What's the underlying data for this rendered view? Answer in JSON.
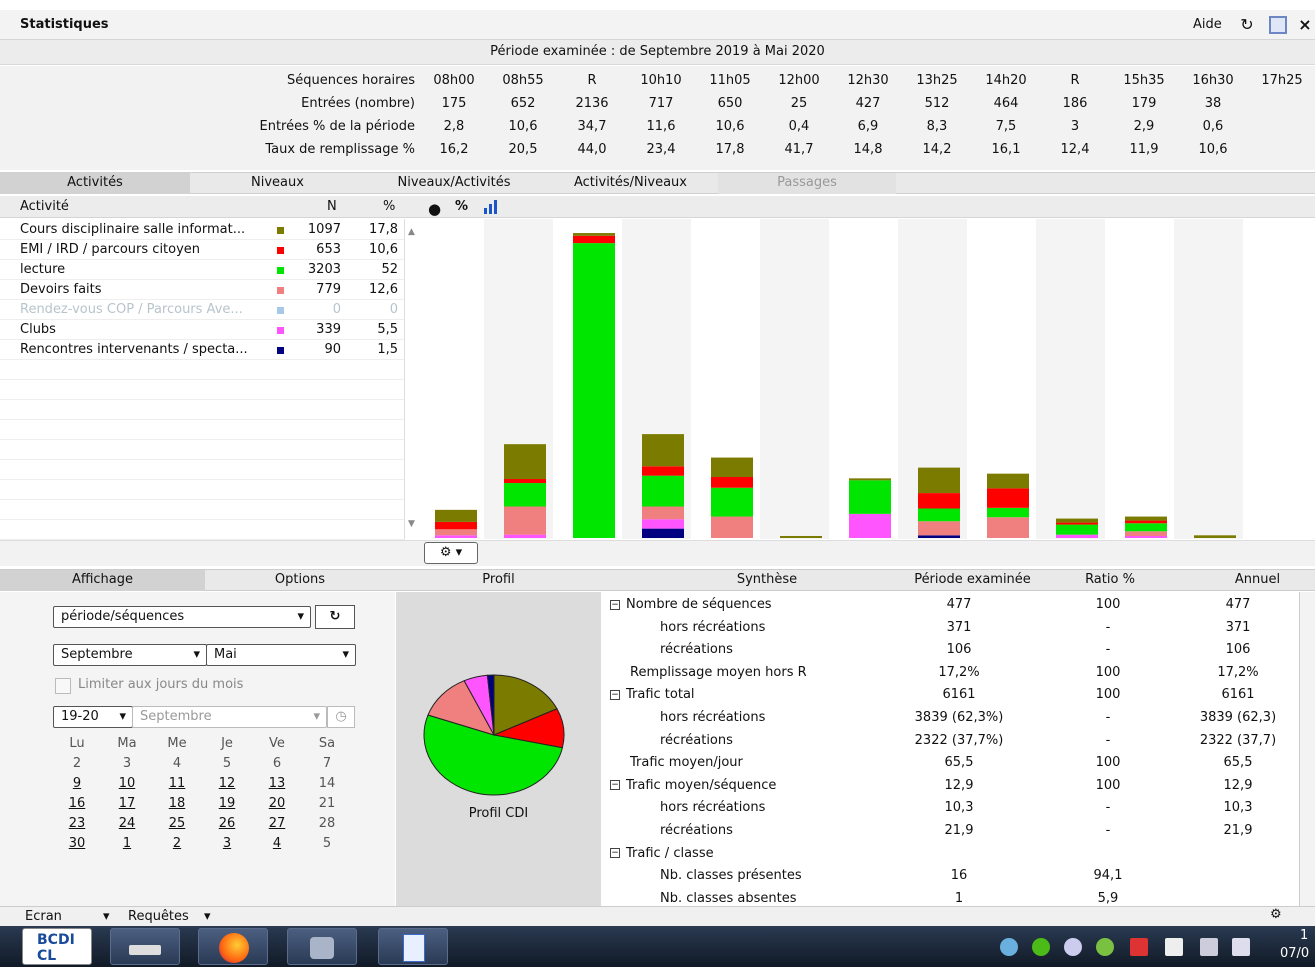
{
  "window": {
    "title": "Statistiques",
    "help": "Aide",
    "refresh_icon": "refresh-icon",
    "restore_icon": "window-icon",
    "close_icon": "×"
  },
  "period": "Période examinée : de Septembre 2019 à Mai 2020",
  "sequences": {
    "row_labels": [
      "Séquences horaires",
      "Entrées (nombre)",
      "Entrées % de la période",
      "Taux de remplissage %"
    ],
    "times": [
      "08h00",
      "08h55",
      "R",
      "10h10",
      "11h05",
      "12h00",
      "12h30",
      "13h25",
      "14h20",
      "R",
      "15h35",
      "16h30",
      "17h25"
    ],
    "entries": [
      "175",
      "652",
      "2136",
      "717",
      "650",
      "25",
      "427",
      "512",
      "464",
      "186",
      "179",
      "38",
      ""
    ],
    "entries_pct": [
      "2,8",
      "10,6",
      "34,7",
      "11,6",
      "10,6",
      "0,4",
      "6,9",
      "8,3",
      "7,5",
      "3",
      "2,9",
      "0,6",
      ""
    ],
    "fill_rate": [
      "16,2",
      "20,5",
      "44,0",
      "23,4",
      "17,8",
      "41,7",
      "14,8",
      "14,2",
      "16,1",
      "12,4",
      "11,9",
      "10,6",
      ""
    ]
  },
  "tabs_top": [
    "Activités",
    "Niveaux",
    "Niveaux/Activités",
    "Activités/Niveaux",
    "Passages"
  ],
  "activity_header": {
    "activity": "Activité",
    "n": "N",
    "pct": "%",
    "toolbar_pct": "%"
  },
  "activities": [
    {
      "name": "Cours disciplinaire salle informat...",
      "n": "1097",
      "pct": "17,8",
      "color": "#7b7b00",
      "disabled": false
    },
    {
      "name": "EMI / IRD / parcours citoyen",
      "n": "653",
      "pct": "10,6",
      "color": "#ff0000",
      "disabled": false
    },
    {
      "name": "lecture",
      "n": "3203",
      "pct": "52",
      "color": "#00e600",
      "disabled": false
    },
    {
      "name": "Devoirs faits",
      "n": "779",
      "pct": "12,6",
      "color": "#f08080",
      "disabled": false
    },
    {
      "name": "Rendez-vous COP / Parcours Ave...",
      "n": "0",
      "pct": "0",
      "color": "#a8c8e8",
      "disabled": true
    },
    {
      "name": "Clubs",
      "n": "339",
      "pct": "5,5",
      "color": "#ff55ff",
      "disabled": false
    },
    {
      "name": "Rencontres intervenants / specta...",
      "n": "90",
      "pct": "1,5",
      "color": "#000080",
      "disabled": false
    }
  ],
  "chart_data": {
    "type": "bar",
    "stacked": true,
    "categories": [
      "08h00",
      "08h55",
      "R",
      "10h10",
      "11h05",
      "12h00",
      "12h30",
      "13h25",
      "14h20",
      "R",
      "15h35",
      "16h30",
      "17h25"
    ],
    "series": [
      {
        "name": "Rencontres intervenants / specta...",
        "color": "#000080",
        "values": [
          0,
          0,
          0,
          28,
          0,
          0,
          0,
          8,
          0,
          0,
          0,
          0,
          0
        ]
      },
      {
        "name": "Clubs",
        "color": "#ff55ff",
        "values": [
          8,
          10,
          0,
          28,
          0,
          0,
          72,
          0,
          0,
          10,
          6,
          0,
          0
        ]
      },
      {
        "name": "Devoirs faits",
        "color": "#f08080",
        "values": [
          18,
          84,
          0,
          38,
          64,
          0,
          0,
          42,
          62,
          0,
          14,
          0,
          0
        ]
      },
      {
        "name": "lecture",
        "color": "#00e600",
        "values": [
          0,
          70,
          880,
          92,
          86,
          0,
          100,
          38,
          28,
          30,
          24,
          0,
          0
        ]
      },
      {
        "name": "EMI / IRD / parcours citoyen",
        "color": "#ff0000",
        "values": [
          22,
          12,
          22,
          28,
          32,
          0,
          0,
          46,
          58,
          6,
          8,
          0,
          0
        ]
      },
      {
        "name": "Cours disciplinaire salle informat...",
        "color": "#7b7b00",
        "values": [
          36,
          104,
          8,
          96,
          58,
          6,
          6,
          76,
          44,
          12,
          12,
          8,
          0
        ]
      }
    ],
    "ylim": [
      0,
      940
    ],
    "grid": false,
    "legend": "left-list"
  },
  "gear_button": {
    "icon": "gear-icon",
    "label": "▾"
  },
  "tabs_bottom": [
    "Affichage",
    "Options",
    "Profil",
    "Synthèse",
    "Période examinée",
    "Ratio %",
    "Annuel"
  ],
  "display": {
    "mode": "période/séquences",
    "month_from": "Septembre",
    "month_to": "Mai",
    "limit_days": "Limiter aux jours du mois",
    "year": "19-20",
    "month": "Septembre"
  },
  "calendar": {
    "days": [
      "Lu",
      "Ma",
      "Me",
      "Je",
      "Ve",
      "Sa"
    ],
    "weeks": [
      [
        "2",
        "3",
        "4",
        "5",
        "6",
        "7"
      ],
      [
        "9",
        "10",
        "11",
        "12",
        "13",
        "14"
      ],
      [
        "16",
        "17",
        "18",
        "19",
        "20",
        "21"
      ],
      [
        "23",
        "24",
        "25",
        "26",
        "27",
        "28"
      ],
      [
        "30",
        "1",
        "2",
        "3",
        "4",
        "5"
      ]
    ]
  },
  "profile": {
    "label": "Profil CDI",
    "slices": [
      {
        "value": 17.8,
        "color": "#7b7b00"
      },
      {
        "value": 10.6,
        "color": "#ff0000"
      },
      {
        "value": 52,
        "color": "#00e600"
      },
      {
        "value": 12.6,
        "color": "#f08080"
      },
      {
        "value": 5.5,
        "color": "#ff55ff"
      },
      {
        "value": 1.5,
        "color": "#000080"
      }
    ]
  },
  "synthesis": [
    {
      "label": "Nombre de séquences",
      "level": 0,
      "expand": true,
      "p": "477",
      "r": "100",
      "a": "477"
    },
    {
      "label": "hors récréations",
      "level": 1,
      "expand": false,
      "p": "371",
      "r": "-",
      "a": "371"
    },
    {
      "label": "récréations",
      "level": 1,
      "expand": false,
      "p": "106",
      "r": "-",
      "a": "106"
    },
    {
      "label": "Remplissage moyen hors R",
      "level": 0,
      "expand": false,
      "p": "17,2%",
      "r": "100",
      "a": "17,2%"
    },
    {
      "label": "Trafic total",
      "level": 0,
      "expand": true,
      "p": "6161",
      "r": "100",
      "a": "6161"
    },
    {
      "label": "hors récréations",
      "level": 1,
      "expand": false,
      "p": "3839 (62,3%)",
      "r": "-",
      "a": "3839 (62,3)"
    },
    {
      "label": "récréations",
      "level": 1,
      "expand": false,
      "p": "2322 (37,7%)",
      "r": "-",
      "a": "2322 (37,7)"
    },
    {
      "label": "Trafic moyen/jour",
      "level": 0,
      "expand": false,
      "p": "65,5",
      "r": "100",
      "a": "65,5"
    },
    {
      "label": "Trafic moyen/séquence",
      "level": 0,
      "expand": true,
      "p": "12,9",
      "r": "100",
      "a": "12,9"
    },
    {
      "label": "hors récréations",
      "level": 1,
      "expand": false,
      "p": "10,3",
      "r": "-",
      "a": "10,3"
    },
    {
      "label": "récréations",
      "level": 1,
      "expand": false,
      "p": "21,9",
      "r": "-",
      "a": "21,9"
    },
    {
      "label": "Trafic / classe",
      "level": 0,
      "expand": true,
      "p": "",
      "r": "",
      "a": ""
    },
    {
      "label": "Nb. classes présentes",
      "level": 1,
      "expand": false,
      "p": "16",
      "r": "94,1",
      "a": ""
    },
    {
      "label": "Nb. classes absentes",
      "level": 1,
      "expand": false,
      "p": "1",
      "r": "5,9",
      "a": ""
    }
  ],
  "bottombar": {
    "screen": "Ecran",
    "queries": "Requêtes"
  },
  "taskbar": {
    "apps": [
      "BCDI CL",
      "drive",
      "firefox",
      "users",
      "document"
    ],
    "clock_top": "1",
    "clock_bottom": "07/0"
  }
}
